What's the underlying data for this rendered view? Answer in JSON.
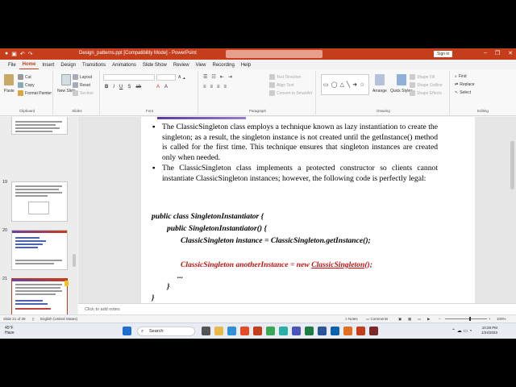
{
  "titlebar": {
    "document_title": "Design_patterns.ppt [Compatibility Mode]  -  PowerPoint",
    "signin_label": "Sign in",
    "window_controls": [
      "minimize",
      "restore",
      "close"
    ]
  },
  "menu": {
    "tabs": [
      "File",
      "Home",
      "Insert",
      "Design",
      "Transitions",
      "Animations",
      "Slide Show",
      "Review",
      "View",
      "Recording",
      "Help"
    ],
    "active_tab": "Home"
  },
  "ribbon": {
    "clipboard": {
      "paste": "Paste",
      "cut": "Cut",
      "copy": "Copy",
      "format_painter": "Format Painter",
      "label": "Clipboard"
    },
    "slides": {
      "new_slide": "New Slide",
      "layout": "Layout",
      "reset": "Reset",
      "section": "Section",
      "label": "Slides"
    },
    "font": {
      "label": "Font"
    },
    "paragraph": {
      "text_direction": "Text Direction",
      "align_text": "Align Text",
      "convert_smartart": "Convert to SmartArt",
      "label": "Paragraph"
    },
    "drawing": {
      "arrange": "Arrange",
      "quick_styles": "Quick Styles",
      "shape_fill": "Shape Fill",
      "shape_outline": "Shape Outline",
      "shape_effects": "Shape Effects",
      "label": "Drawing"
    },
    "editing": {
      "find": "Find",
      "replace": "Replace",
      "select": "Select",
      "label": "Editing"
    }
  },
  "thumbnails": [
    {
      "number": "",
      "selected": false
    },
    {
      "number": "19",
      "selected": false
    },
    {
      "number": "20",
      "selected": false
    },
    {
      "number": "21",
      "selected": true
    },
    {
      "number": "22",
      "selected": false
    }
  ],
  "slide": {
    "bullet1": "The ClassicSingleton class employs a technique known as lazy instantiation to create the singleton; as a result, the singleton instance is not created until the getInstance() method is called for the first time. This technique ensures that singleton instances are created only when needed.",
    "bullet2": "The ClassicSingleton class implements a protected constructor so clients cannot instantiate ClassicSingleton instances; however, the following code is perfectly legal:",
    "code": {
      "line1": "public class SingletonInstantiator {",
      "line2": "public SingletonInstantiator() {",
      "line3": "ClassicSingleton instance = ClassicSingleton.getInstance();",
      "line4_prefix": "ClassicSingleton anotherInstance = new ",
      "line4_link": "ClassicSingleton",
      "line4_suffix": "();",
      "line5": "...",
      "line6": "}",
      "line7": "}"
    }
  },
  "notes": {
    "placeholder": "Click to add notes"
  },
  "status": {
    "slide_info": "Slide 21 of 39",
    "language": "English (United States)",
    "notes_label": "Notes",
    "comments_label": "Comments",
    "zoom": "100%"
  },
  "taskbar": {
    "weather_temp": "45°F",
    "weather_desc": "Haze",
    "search_label": "Search",
    "time": "10:28 PM",
    "date": "1/24/2023"
  },
  "colors": {
    "accent": "#c43e1c",
    "code_red": "#c01010"
  }
}
